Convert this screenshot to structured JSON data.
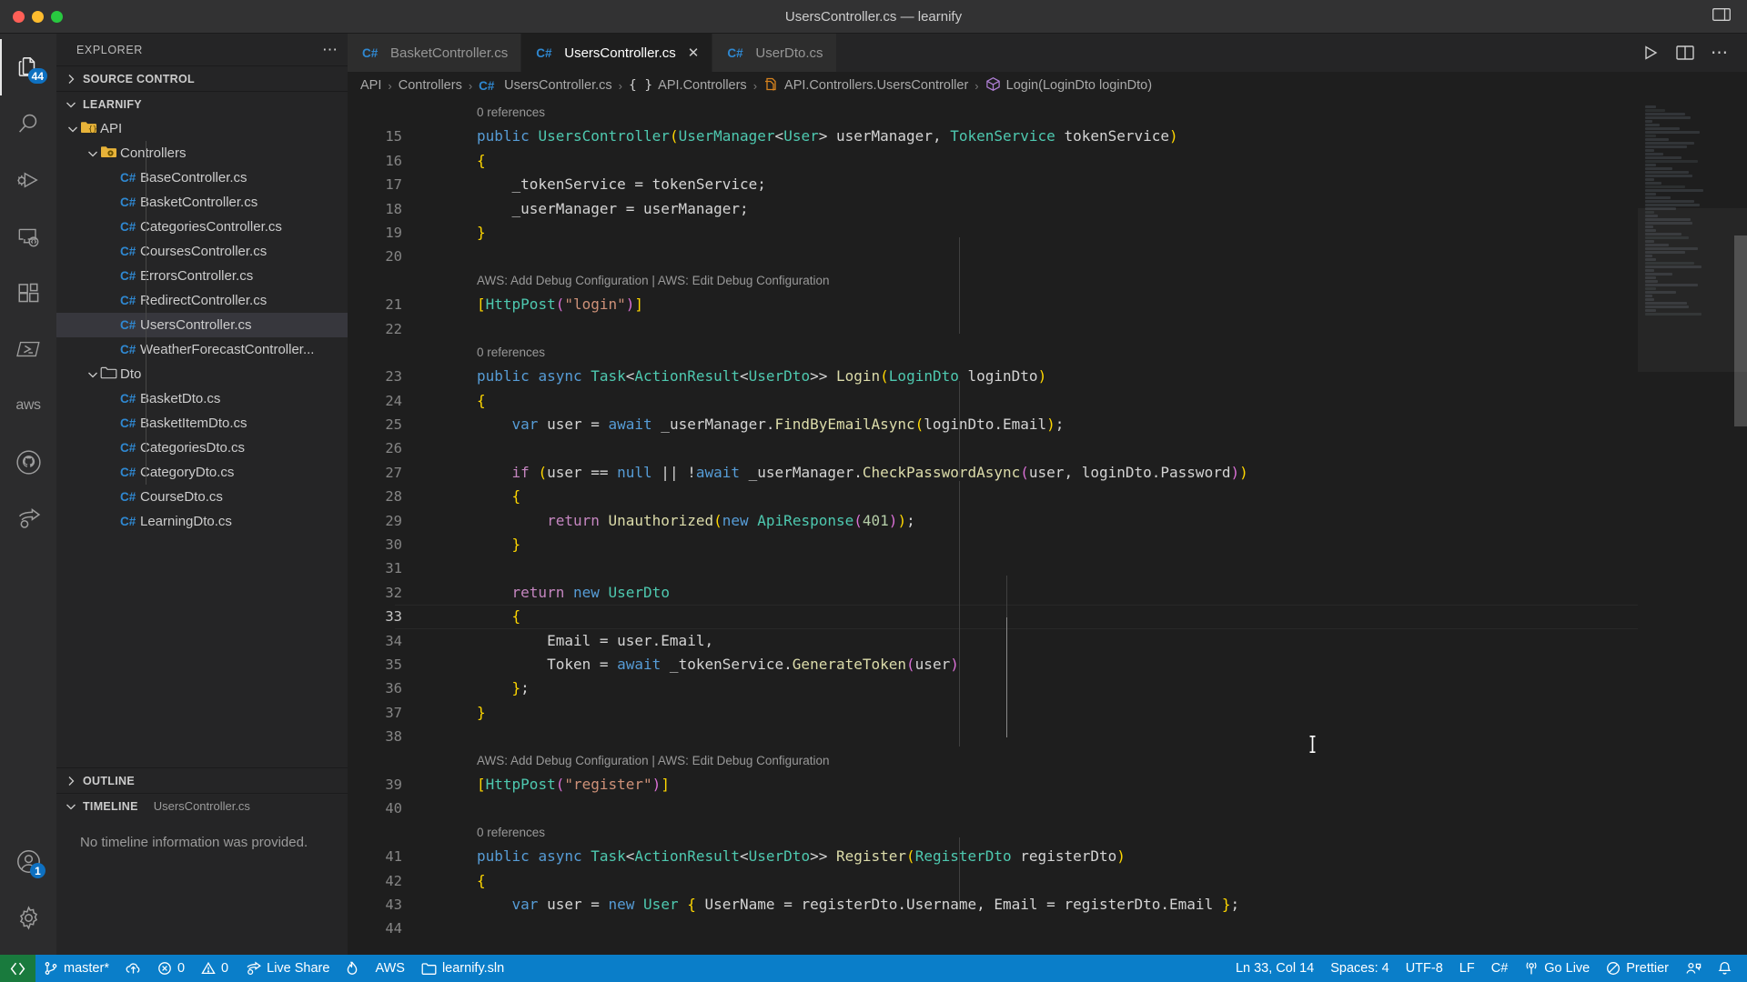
{
  "window": {
    "title": "UsersController.cs — learnify",
    "traffic_lights": [
      "close",
      "minimize",
      "zoom"
    ],
    "layout_icon": "editor-layout-icon"
  },
  "activitybar": {
    "items": [
      {
        "name": "explorer",
        "icon": "files-icon",
        "badge": "44",
        "active": true
      },
      {
        "name": "search",
        "icon": "search-icon",
        "badge": "",
        "active": false
      },
      {
        "name": "run-and-debug",
        "icon": "debug-icon",
        "badge": "",
        "active": false
      },
      {
        "name": "remote-explorer",
        "icon": "remote-icon",
        "badge": "",
        "active": false
      },
      {
        "name": "extensions",
        "icon": "extensions-icon",
        "badge": "",
        "active": false
      },
      {
        "name": "terminal-powershell",
        "icon": "powershell-icon",
        "badge": "",
        "active": false
      },
      {
        "name": "aws-toolkit",
        "icon": "aws-icon",
        "badge": "",
        "active": false
      },
      {
        "name": "github",
        "icon": "github-icon",
        "badge": "",
        "active": false
      },
      {
        "name": "live-share",
        "icon": "live-share-icon",
        "badge": "",
        "active": false
      }
    ],
    "bottom_items": [
      {
        "name": "accounts",
        "icon": "account-icon",
        "badge": "1"
      },
      {
        "name": "manage",
        "icon": "gear-icon",
        "badge": ""
      }
    ]
  },
  "sidebar": {
    "header": "EXPLORER",
    "more_actions": "⋯",
    "sections": [
      {
        "label": "SOURCE CONTROL",
        "expanded": false
      },
      {
        "label": "LEARNIFY",
        "expanded": true
      },
      {
        "label": "OUTLINE",
        "expanded": false
      },
      {
        "label": "TIMELINE",
        "expanded": true,
        "detail": "UsersController.cs"
      }
    ],
    "timeline_empty": "No timeline information was provided.",
    "tree": [
      {
        "label": "API",
        "type": "folder-api",
        "depth": 1,
        "expanded": true,
        "selected": false
      },
      {
        "label": "Controllers",
        "type": "folder-controllers",
        "depth": 2,
        "expanded": true,
        "selected": false
      },
      {
        "label": "BaseController.cs",
        "type": "csharp",
        "depth": 3,
        "selected": false
      },
      {
        "label": "BasketController.cs",
        "type": "csharp",
        "depth": 3,
        "selected": false
      },
      {
        "label": "CategoriesController.cs",
        "type": "csharp",
        "depth": 3,
        "selected": false
      },
      {
        "label": "CoursesController.cs",
        "type": "csharp",
        "depth": 3,
        "selected": false
      },
      {
        "label": "ErrorsController.cs",
        "type": "csharp",
        "depth": 3,
        "selected": false
      },
      {
        "label": "RedirectController.cs",
        "type": "csharp",
        "depth": 3,
        "selected": false
      },
      {
        "label": "UsersController.cs",
        "type": "csharp",
        "depth": 3,
        "selected": true
      },
      {
        "label": "WeatherForecastController...",
        "type": "csharp",
        "depth": 3,
        "selected": false
      },
      {
        "label": "Dto",
        "type": "folder",
        "depth": 2,
        "expanded": true,
        "selected": false
      },
      {
        "label": "BasketDto.cs",
        "type": "csharp",
        "depth": 3,
        "selected": false
      },
      {
        "label": "BasketItemDto.cs",
        "type": "csharp",
        "depth": 3,
        "selected": false
      },
      {
        "label": "CategoriesDto.cs",
        "type": "csharp",
        "depth": 3,
        "selected": false
      },
      {
        "label": "CategoryDto.cs",
        "type": "csharp",
        "depth": 3,
        "selected": false
      },
      {
        "label": "CourseDto.cs",
        "type": "csharp",
        "depth": 3,
        "selected": false
      },
      {
        "label": "LearningDto.cs",
        "type": "csharp",
        "depth": 3,
        "selected": false
      }
    ]
  },
  "editor": {
    "tabs": [
      {
        "label": "BasketController.cs",
        "icon": "csharp-icon",
        "active": false,
        "closable": false
      },
      {
        "label": "UsersController.cs",
        "icon": "csharp-icon",
        "active": true,
        "closable": true
      },
      {
        "label": "UserDto.cs",
        "icon": "csharp-icon",
        "active": false,
        "closable": false
      }
    ],
    "tab_actions": [
      {
        "name": "run-file-button",
        "icon": "play-icon"
      },
      {
        "name": "split-editor-button",
        "icon": "split-editor-icon"
      },
      {
        "name": "more-actions-button",
        "icon": "ellipsis-icon"
      }
    ],
    "breadcrumbs": [
      {
        "label": "API",
        "icon": ""
      },
      {
        "label": "Controllers",
        "icon": ""
      },
      {
        "label": "UsersController.cs",
        "icon": "csharp-icon"
      },
      {
        "label": "API.Controllers",
        "icon": "namespace-icon"
      },
      {
        "label": "API.Controllers.UsersController",
        "icon": "class-icon"
      },
      {
        "label": "Login(LoginDto loginDto)",
        "icon": "method-icon"
      }
    ],
    "first_visible_line": 15,
    "current_line": 33,
    "lines": [
      {
        "n": null,
        "kind": "codelens",
        "text": "0 references"
      },
      {
        "n": 15,
        "kind": "code",
        "tokens": [
          [
            "k",
            "public "
          ],
          [
            "t",
            "UsersController"
          ],
          [
            "b1",
            "("
          ],
          [
            "t",
            "UserManager"
          ],
          [
            "p",
            "<"
          ],
          [
            "t",
            "User"
          ],
          [
            "p",
            "> userManager, "
          ],
          [
            "t",
            "TokenService"
          ],
          [
            "p",
            " tokenService"
          ],
          [
            "b1",
            ")"
          ]
        ]
      },
      {
        "n": 16,
        "kind": "code",
        "tokens": [
          [
            "b1",
            "{"
          ]
        ]
      },
      {
        "n": 17,
        "kind": "code",
        "tokens": [
          [
            "p",
            "    _tokenService = tokenService;"
          ]
        ]
      },
      {
        "n": 18,
        "kind": "code",
        "tokens": [
          [
            "p",
            "    _userManager = userManager;"
          ]
        ]
      },
      {
        "n": 19,
        "kind": "code",
        "tokens": [
          [
            "b1",
            "}"
          ]
        ]
      },
      {
        "n": 20,
        "kind": "code",
        "tokens": []
      },
      {
        "n": null,
        "kind": "codelens",
        "text": "AWS: Add Debug Configuration | AWS: Edit Debug Configuration"
      },
      {
        "n": 21,
        "kind": "code",
        "tokens": [
          [
            "b1",
            "["
          ],
          [
            "t",
            "HttpPost"
          ],
          [
            "b2",
            "("
          ],
          [
            "s",
            "\"login\""
          ],
          [
            "b2",
            ")"
          ],
          [
            "b1",
            "]"
          ]
        ]
      },
      {
        "n": 22,
        "kind": "code",
        "tokens": []
      },
      {
        "n": null,
        "kind": "codelens",
        "text": "0 references"
      },
      {
        "n": 23,
        "kind": "code",
        "tokens": [
          [
            "k",
            "public "
          ],
          [
            "k",
            "async "
          ],
          [
            "t",
            "Task"
          ],
          [
            "p",
            "<"
          ],
          [
            "t",
            "ActionResult"
          ],
          [
            "p",
            "<"
          ],
          [
            "t",
            "UserDto"
          ],
          [
            "p",
            ">> "
          ],
          [
            "f",
            "Login"
          ],
          [
            "b1",
            "("
          ],
          [
            "t",
            "LoginDto"
          ],
          [
            "p",
            " loginDto"
          ],
          [
            "b1",
            ")"
          ]
        ]
      },
      {
        "n": 24,
        "kind": "code",
        "tokens": [
          [
            "b1",
            "{"
          ]
        ]
      },
      {
        "n": 25,
        "kind": "code",
        "tokens": [
          [
            "p",
            "    "
          ],
          [
            "k",
            "var"
          ],
          [
            "p",
            " user = "
          ],
          [
            "k",
            "await"
          ],
          [
            "p",
            " _userManager."
          ],
          [
            "f",
            "FindByEmailAsync"
          ],
          [
            "b1",
            "("
          ],
          [
            "p",
            "loginDto.Email"
          ],
          [
            "b1",
            ")"
          ],
          [
            "p",
            ";"
          ]
        ]
      },
      {
        "n": 26,
        "kind": "code",
        "tokens": []
      },
      {
        "n": 27,
        "kind": "code",
        "tokens": [
          [
            "p",
            "    "
          ],
          [
            "kc",
            "if"
          ],
          [
            "p",
            " "
          ],
          [
            "b1",
            "("
          ],
          [
            "p",
            "user == "
          ],
          [
            "k",
            "null"
          ],
          [
            "p",
            " || !"
          ],
          [
            "k",
            "await"
          ],
          [
            "p",
            " _userManager."
          ],
          [
            "f",
            "CheckPasswordAsync"
          ],
          [
            "b2",
            "("
          ],
          [
            "p",
            "user, loginDto.Password"
          ],
          [
            "b2",
            ")"
          ],
          [
            "b1",
            ")"
          ]
        ]
      },
      {
        "n": 28,
        "kind": "code",
        "tokens": [
          [
            "p",
            "    "
          ],
          [
            "b1",
            "{"
          ]
        ]
      },
      {
        "n": 29,
        "kind": "code",
        "tokens": [
          [
            "p",
            "        "
          ],
          [
            "kc",
            "return"
          ],
          [
            "p",
            " "
          ],
          [
            "f",
            "Unauthorized"
          ],
          [
            "b1",
            "("
          ],
          [
            "k",
            "new"
          ],
          [
            "p",
            " "
          ],
          [
            "t",
            "ApiResponse"
          ],
          [
            "b2",
            "("
          ],
          [
            "n",
            "401"
          ],
          [
            "b2",
            ")"
          ],
          [
            "b1",
            ")"
          ],
          [
            "p",
            ";"
          ]
        ]
      },
      {
        "n": 30,
        "kind": "code",
        "tokens": [
          [
            "p",
            "    "
          ],
          [
            "b1",
            "}"
          ]
        ]
      },
      {
        "n": 31,
        "kind": "code",
        "tokens": []
      },
      {
        "n": 32,
        "kind": "code",
        "tokens": [
          [
            "p",
            "    "
          ],
          [
            "kc",
            "return"
          ],
          [
            "p",
            " "
          ],
          [
            "k",
            "new"
          ],
          [
            "p",
            " "
          ],
          [
            "t",
            "UserDto"
          ]
        ]
      },
      {
        "n": 33,
        "kind": "code",
        "current": true,
        "tokens": [
          [
            "p",
            "    "
          ],
          [
            "b1",
            "{"
          ]
        ]
      },
      {
        "n": 34,
        "kind": "code",
        "tokens": [
          [
            "p",
            "        Email = user.Email,"
          ]
        ]
      },
      {
        "n": 35,
        "kind": "code",
        "tokens": [
          [
            "p",
            "        Token = "
          ],
          [
            "k",
            "await"
          ],
          [
            "p",
            " _tokenService."
          ],
          [
            "f",
            "GenerateToken"
          ],
          [
            "b2",
            "("
          ],
          [
            "p",
            "user"
          ],
          [
            "b2",
            ")"
          ]
        ]
      },
      {
        "n": 36,
        "kind": "code",
        "tokens": [
          [
            "p",
            "    "
          ],
          [
            "b1",
            "}"
          ],
          [
            "p",
            ";"
          ]
        ]
      },
      {
        "n": 37,
        "kind": "code",
        "tokens": [
          [
            "b1",
            "}"
          ]
        ]
      },
      {
        "n": 38,
        "kind": "code",
        "tokens": []
      },
      {
        "n": null,
        "kind": "codelens",
        "text": "AWS: Add Debug Configuration | AWS: Edit Debug Configuration"
      },
      {
        "n": 39,
        "kind": "code",
        "tokens": [
          [
            "b1",
            "["
          ],
          [
            "t",
            "HttpPost"
          ],
          [
            "b2",
            "("
          ],
          [
            "s",
            "\"register\""
          ],
          [
            "b2",
            ")"
          ],
          [
            "b1",
            "]"
          ]
        ]
      },
      {
        "n": 40,
        "kind": "code",
        "tokens": []
      },
      {
        "n": null,
        "kind": "codelens",
        "text": "0 references"
      },
      {
        "n": 41,
        "kind": "code",
        "tokens": [
          [
            "k",
            "public "
          ],
          [
            "k",
            "async "
          ],
          [
            "t",
            "Task"
          ],
          [
            "p",
            "<"
          ],
          [
            "t",
            "ActionResult"
          ],
          [
            "p",
            "<"
          ],
          [
            "t",
            "UserDto"
          ],
          [
            "p",
            ">> "
          ],
          [
            "f",
            "Register"
          ],
          [
            "b1",
            "("
          ],
          [
            "t",
            "RegisterDto"
          ],
          [
            "p",
            " registerDto"
          ],
          [
            "b1",
            ")"
          ]
        ]
      },
      {
        "n": 42,
        "kind": "code",
        "tokens": [
          [
            "b1",
            "{"
          ]
        ]
      },
      {
        "n": 43,
        "kind": "code",
        "tokens": [
          [
            "p",
            "    "
          ],
          [
            "k",
            "var"
          ],
          [
            "p",
            " user = "
          ],
          [
            "k",
            "new"
          ],
          [
            "p",
            " "
          ],
          [
            "t",
            "User"
          ],
          [
            "p",
            " "
          ],
          [
            "b1",
            "{"
          ],
          [
            "p",
            " UserName = registerDto.Username, Email = registerDto.Email "
          ],
          [
            "b1",
            "}"
          ],
          [
            "p",
            ";"
          ]
        ]
      },
      {
        "n": 44,
        "kind": "code",
        "tokens": []
      }
    ]
  },
  "statusbar": {
    "left": [
      {
        "name": "remote-window",
        "icon": "remote-indicator-icon",
        "label": ""
      },
      {
        "name": "branch",
        "icon": "source-control-icon",
        "label": "master*"
      },
      {
        "name": "sync-changes",
        "icon": "cloud-upload-icon",
        "label": ""
      },
      {
        "name": "problems-errors",
        "icon": "error-icon",
        "label": "0"
      },
      {
        "name": "problems-warnings",
        "icon": "warning-icon",
        "label": "0"
      },
      {
        "name": "live-share",
        "icon": "live-share-icon",
        "label": "Live Share"
      },
      {
        "name": "vscode-hot-reload",
        "icon": "flame-icon",
        "label": ""
      },
      {
        "name": "aws-connection",
        "icon": "",
        "label": "AWS"
      },
      {
        "name": "solution",
        "icon": "folder-icon",
        "label": "learnify.sln"
      }
    ],
    "right": [
      {
        "name": "cursor-position",
        "icon": "",
        "label": "Ln 33, Col 14"
      },
      {
        "name": "indentation",
        "icon": "",
        "label": "Spaces: 4"
      },
      {
        "name": "encoding",
        "icon": "",
        "label": "UTF-8"
      },
      {
        "name": "end-of-line",
        "icon": "",
        "label": "LF"
      },
      {
        "name": "language-mode",
        "icon": "",
        "label": "C#"
      },
      {
        "name": "go-live",
        "icon": "broadcast-icon",
        "label": "Go Live"
      },
      {
        "name": "prettier",
        "icon": "prettier-check-icon",
        "label": "Prettier"
      },
      {
        "name": "feedback",
        "icon": "feedback-icon",
        "label": ""
      },
      {
        "name": "notifications",
        "icon": "bell-icon",
        "label": ""
      }
    ]
  },
  "colors": {
    "accent_blue": "#0a7ec9",
    "remote_green": "#197a3d",
    "editor_bg": "#1e1e1e",
    "sidebar_bg": "#252526",
    "activitybar_bg": "#2c2c2d",
    "badge_blue": "#0e70c0",
    "selection": "#37373d"
  }
}
